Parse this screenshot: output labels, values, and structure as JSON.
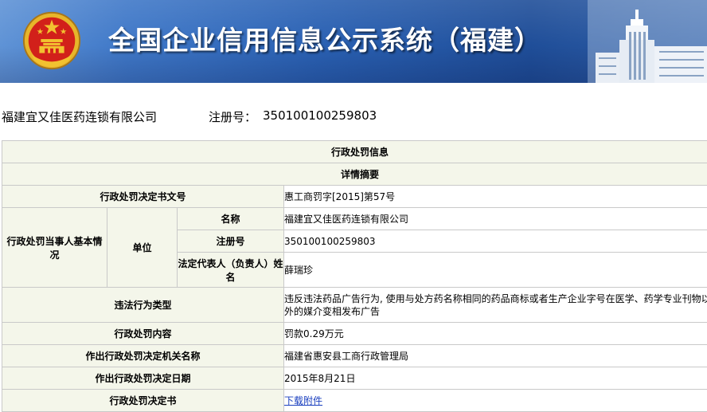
{
  "header": {
    "title": "全国企业信用信息公示系统（福建）"
  },
  "company": {
    "name": "福建宜又佳医药连锁有限公司",
    "reg_label": "注册号：",
    "reg_value": "350100100259803"
  },
  "section": {
    "title": "行政处罚信息",
    "subtitle": "详情摘要"
  },
  "rows": {
    "doc_no_label": "行政处罚决定书文号",
    "doc_no_value": "惠工商罚字[2015]第57号",
    "party_label": "行政处罚当事人基本情况",
    "unit_label": "单位",
    "name_label": "名称",
    "name_value": "福建宜又佳医药连锁有限公司",
    "reg_label": "注册号",
    "reg_value": "350100100259803",
    "rep_label": "法定代表人（负责人）姓名",
    "rep_value": "薛瑞珍",
    "violation_label": "违法行为类型",
    "violation_value": "违反违法药品广告行为, 使用与处方药名称相同的药品商标或者生产企业字号在医学、药学专业刊物以外的媒介变相发布广告",
    "content_label": "行政处罚内容",
    "content_value": "罚款0.29万元",
    "authority_label": "作出行政处罚决定机关名称",
    "authority_value": "福建省惠安县工商行政管理局",
    "date_label": "作出行政处罚决定日期",
    "date_value": "2015年8月21日",
    "decision_label": "行政处罚决定书",
    "decision_link": "下载附件"
  },
  "colors": {
    "banner_blue": "#2a61b3",
    "label_bg": "#f4f6ea",
    "border": "#c9c9c9",
    "link": "#1a3fbf",
    "emblem_red": "#d2201a",
    "emblem_gold": "#f2c230"
  }
}
